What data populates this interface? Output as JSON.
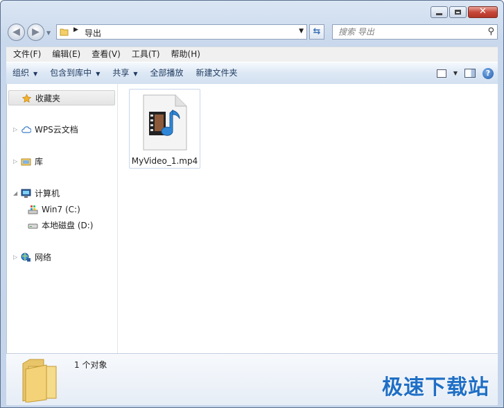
{
  "window": {
    "minimize": "minimize",
    "maximize": "maximize",
    "close": "✕"
  },
  "address": {
    "path": "导出"
  },
  "search": {
    "placeholder": "搜索 导出"
  },
  "menubar": {
    "items": [
      "文件(F)",
      "编辑(E)",
      "查看(V)",
      "工具(T)",
      "帮助(H)"
    ]
  },
  "commandbar": {
    "organize": "组织",
    "include_library": "包含到库中",
    "share": "共享",
    "play_all": "全部播放",
    "new_folder": "新建文件夹",
    "help": "?"
  },
  "nav_pane": {
    "items": [
      {
        "label": "收藏夹",
        "icon": "star-icon"
      },
      {
        "label": "WPS云文档",
        "icon": "cloud-icon"
      },
      {
        "label": "库",
        "icon": "library-icon"
      },
      {
        "label": "计算机",
        "icon": "computer-icon"
      },
      {
        "label": "Win7 (C:)",
        "icon": "system-drive-icon"
      },
      {
        "label": "本地磁盘 (D:)",
        "icon": "hard-drive-icon"
      },
      {
        "label": "网络",
        "icon": "network-icon"
      }
    ]
  },
  "files": [
    {
      "name": "MyVideo_1.mp4",
      "icon": "video-file-icon"
    }
  ],
  "details": {
    "count": "1 个对象"
  },
  "watermark": "极速下载站",
  "colors": {
    "accent": "#1f6fc5",
    "chrome": "#c9d8ec",
    "selection": "#e4e4e4"
  }
}
